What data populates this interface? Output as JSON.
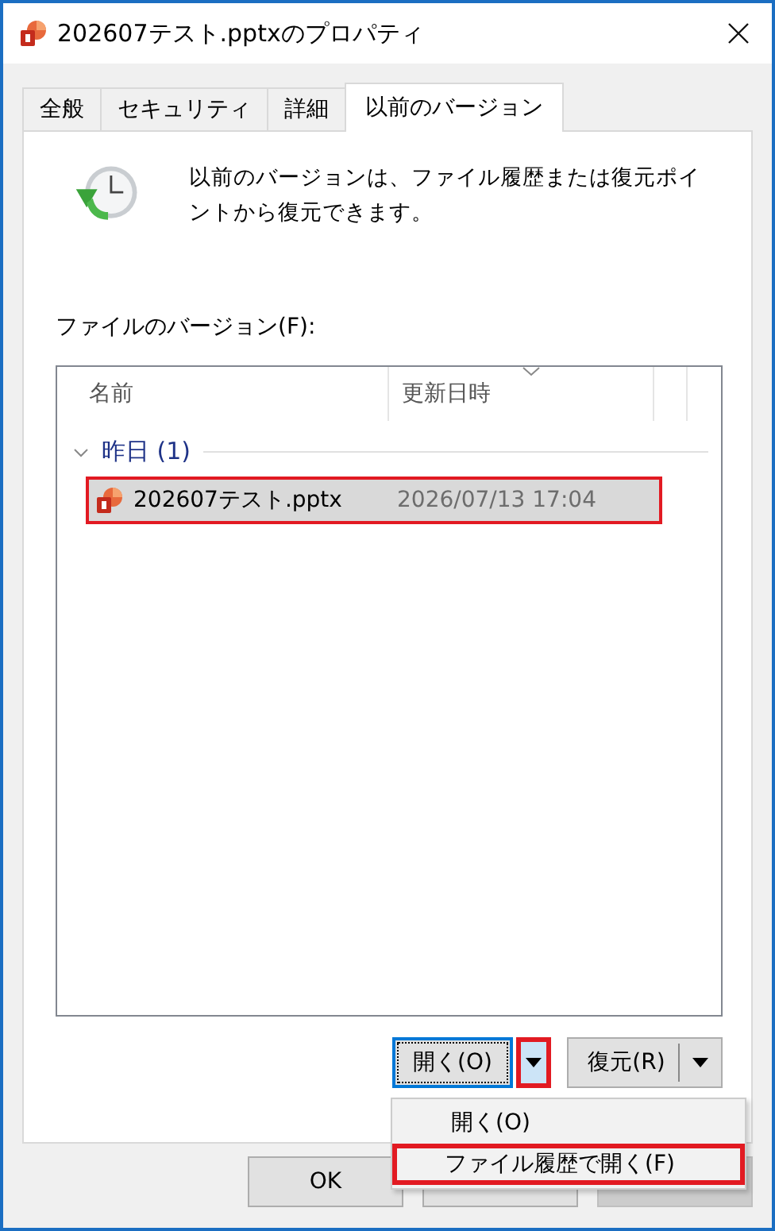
{
  "window": {
    "title": "202607テスト.pptxのプロパティ"
  },
  "tabs": [
    {
      "label": "全般",
      "selected": false
    },
    {
      "label": "セキュリティ",
      "selected": false
    },
    {
      "label": "詳細",
      "selected": false
    },
    {
      "label": "以前のバージョン",
      "selected": true
    }
  ],
  "description": "以前のバージョンは、ファイル履歴または復元ポイントから復元できます。",
  "versions_label": "ファイルのバージョン(F):",
  "list": {
    "columns": [
      "名前",
      "更新日時"
    ],
    "groups": [
      {
        "label": "昨日 (1)",
        "expanded": true,
        "items": [
          {
            "name": "202607テスト.pptx",
            "date": "2026/07/13 17:04",
            "selected": true,
            "annotated": true
          }
        ]
      }
    ]
  },
  "open_button": {
    "label": "開く(O)",
    "focused": true,
    "arrow_annotated": true,
    "arrow_pressed": true
  },
  "restore_button": {
    "label": "復元(R)"
  },
  "menu": {
    "items": [
      {
        "label": "開く(O)",
        "annotated": false
      },
      {
        "label": "ファイル履歴で開く(F)",
        "annotated": true
      }
    ]
  },
  "dialog_buttons": [
    {
      "label": "OK",
      "disabled": false
    },
    {
      "disabled": false
    },
    {
      "disabled": true
    }
  ]
}
